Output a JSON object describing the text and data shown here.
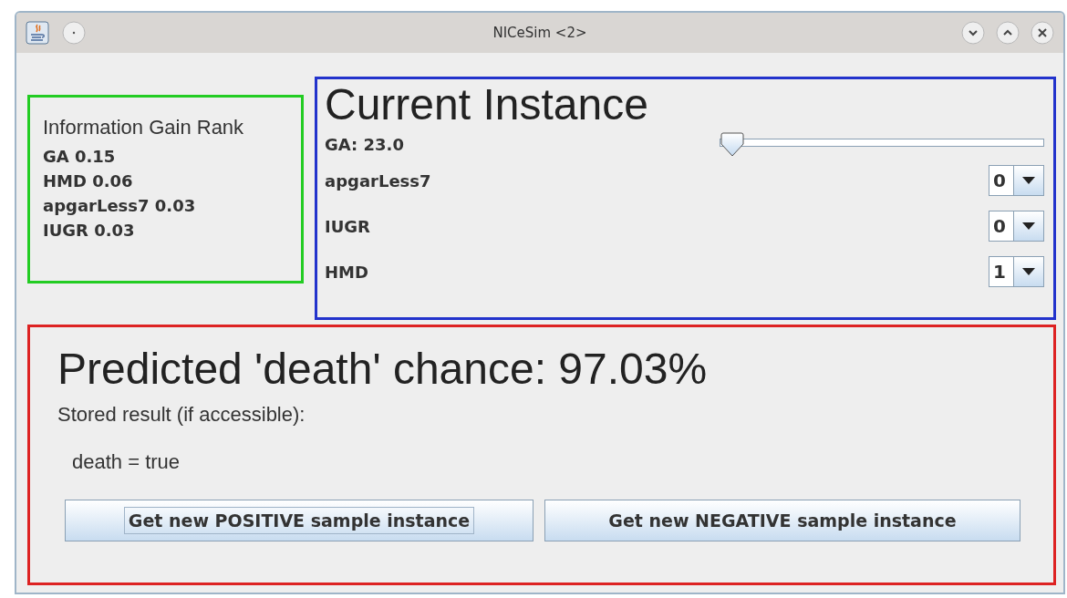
{
  "window": {
    "title": "NICeSim <2>"
  },
  "rank": {
    "title": "Information Gain Rank",
    "items": [
      "GA 0.15",
      "HMD 0.06",
      "apgarLess7 0.03",
      "IUGR 0.03"
    ]
  },
  "instance": {
    "title": "Current Instance",
    "attributes": [
      {
        "kind": "slider",
        "label": "GA: 23.0",
        "level": 0
      },
      {
        "kind": "combo",
        "label": "apgarLess7",
        "value": "0"
      },
      {
        "kind": "combo",
        "label": "IUGR",
        "value": "0"
      },
      {
        "kind": "combo",
        "label": "HMD",
        "value": "1"
      }
    ]
  },
  "prediction": {
    "headline": "Predicted 'death' chance: 97.03%",
    "stored_label": "Stored result (if accessible):",
    "stored_value": "death =  true",
    "buttons": [
      {
        "label": "Get new POSITIVE sample instance",
        "focused": true
      },
      {
        "label": "Get new NEGATIVE sample instance",
        "focused": false
      }
    ]
  }
}
